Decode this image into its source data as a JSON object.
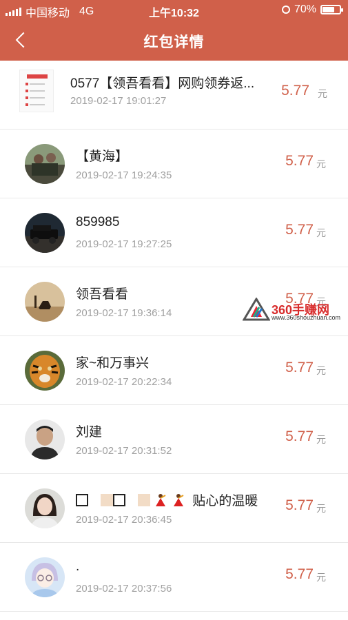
{
  "status_bar": {
    "carrier": "中国移动",
    "network": "4G",
    "time": "上午10:32",
    "battery": "70%",
    "battery_level": 0.7
  },
  "header": {
    "title": "红包详情",
    "back_icon": "chevron-left-icon"
  },
  "list": [
    {
      "name": "0577【领吾看看】网购领券返...",
      "date": "2019-02-17 19:01:27",
      "amount": "5.77",
      "unit": "元"
    },
    {
      "name": "【黄海】",
      "date": "2019-02-17 19:24:35",
      "amount": "5.77",
      "unit": "元"
    },
    {
      "name": "859985",
      "date": "2019-02-17 19:27:25",
      "amount": "5.77",
      "unit": "元"
    },
    {
      "name": "领吾看看",
      "date": "2019-02-17 19:36:14",
      "amount": "5.77",
      "unit": "元"
    },
    {
      "name": "家~和万事兴",
      "date": "2019-02-17 20:22:34",
      "amount": "5.77",
      "unit": "元"
    },
    {
      "name": "刘建",
      "date": "2019-02-17 20:31:52",
      "amount": "5.77",
      "unit": "元"
    },
    {
      "name": "贴心的温暖",
      "date": "2019-02-17 20:36:45",
      "amount": "5.77",
      "unit": "元"
    },
    {
      "name": ".",
      "date": "2019-02-17 20:37:56",
      "amount": "5.77",
      "unit": "元"
    }
  ],
  "watermark": {
    "text": "360手赚网",
    "url": "www.360shouzhuan.com"
  },
  "colors": {
    "accent": "#d0604a",
    "amount": "#d0604a",
    "date": "#a0a0a0"
  }
}
